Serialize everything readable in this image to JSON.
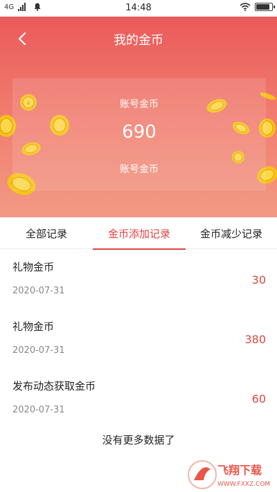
{
  "status_bar": {
    "network": "4G",
    "time": "14:48"
  },
  "header": {
    "title": "我的金币",
    "card": {
      "label_top": "账号金币",
      "value": "690",
      "label_bottom": "账号金币"
    }
  },
  "tabs": [
    {
      "label": "全部记录",
      "active": false
    },
    {
      "label": "金币添加记录",
      "active": true
    },
    {
      "label": "金币减少记录",
      "active": false
    }
  ],
  "records": [
    {
      "title": "礼物金币",
      "date": "2020-07-31",
      "amount": "30"
    },
    {
      "title": "礼物金币",
      "date": "2020-07-31",
      "amount": "380"
    },
    {
      "title": "发布动态获取金币",
      "date": "2020-07-31",
      "amount": "60"
    }
  ],
  "footer": {
    "no_more": "没有更多数据了"
  },
  "watermark": {
    "name": "飞翔下载",
    "url": "WWW.FXXZ.COM"
  },
  "colors": {
    "accent": "#e0413f",
    "header_start": "#ea5a5a",
    "header_end": "#f39a84",
    "amount": "#d84a3e"
  }
}
